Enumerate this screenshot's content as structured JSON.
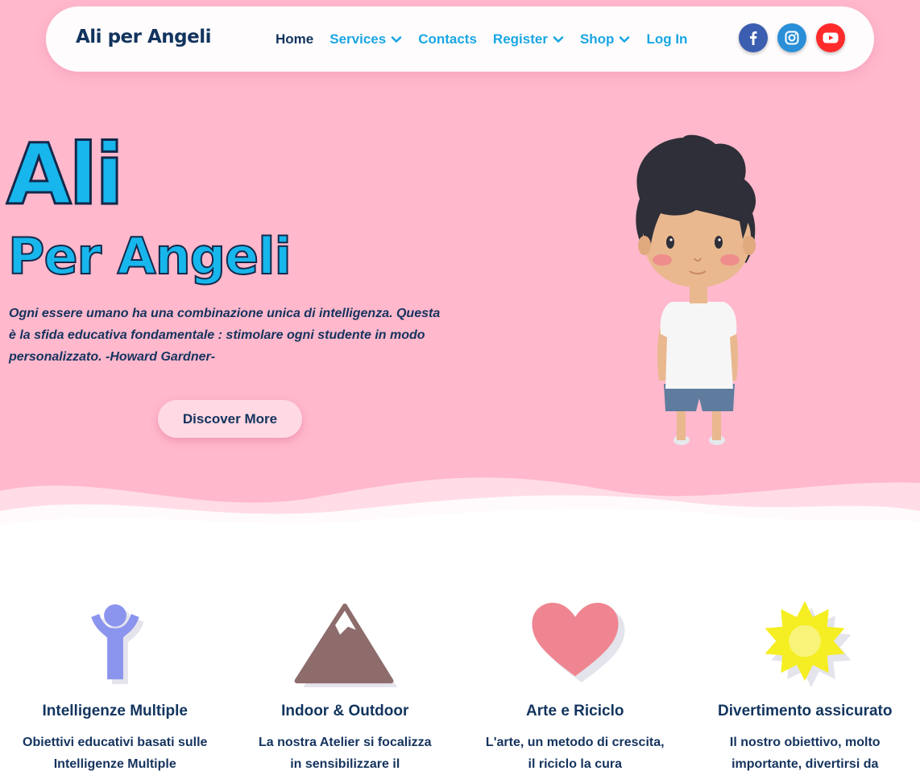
{
  "brand": {
    "logo": "Ali per Angeli"
  },
  "nav": {
    "items": [
      {
        "label": "Home",
        "active": true,
        "dropdown": false
      },
      {
        "label": "Services",
        "active": false,
        "dropdown": true
      },
      {
        "label": "Contacts",
        "active": false,
        "dropdown": false
      },
      {
        "label": "Register",
        "active": false,
        "dropdown": true
      },
      {
        "label": "Shop",
        "active": false,
        "dropdown": true
      },
      {
        "label": "Log In",
        "active": false,
        "dropdown": false
      }
    ],
    "socials": [
      "facebook-icon",
      "instagram-icon",
      "youtube-icon"
    ]
  },
  "hero": {
    "title_line1": "Ali",
    "title_line2": "Per Angeli",
    "quote": "Ogni essere umano ha una combinazione unica di intelligenza. Questa è la sfida educativa fondamentale : stimolare ogni studente in modo personalizzato. -Howard Gardner-",
    "cta_label": "Discover More"
  },
  "features": [
    {
      "icon": "person-icon",
      "title": "Intelligenze Multiple",
      "text": "Obiettivi educativi basati sulle Intelligenze Multiple"
    },
    {
      "icon": "mountain-icon",
      "title": "Indoor & Outdoor",
      "text": "La nostra Atelier si focalizza in sensibilizzare il"
    },
    {
      "icon": "heart-icon",
      "title": "Arte e Riciclo",
      "text": "L'arte, un metodo di crescita, il riciclo la cura"
    },
    {
      "icon": "sun-icon",
      "title": "Divertimento assicurato",
      "text": "Il nostro obiettivo, molto importante, divertirsi da"
    }
  ],
  "colors": {
    "hero_bg": "#ffb8cc",
    "accent_blue": "#1aa6e3",
    "navy": "#12345e",
    "person": "#8c95ee",
    "mountain": "#8e6c6c",
    "heart": "#ef8590",
    "sun": "#f5ee22"
  }
}
